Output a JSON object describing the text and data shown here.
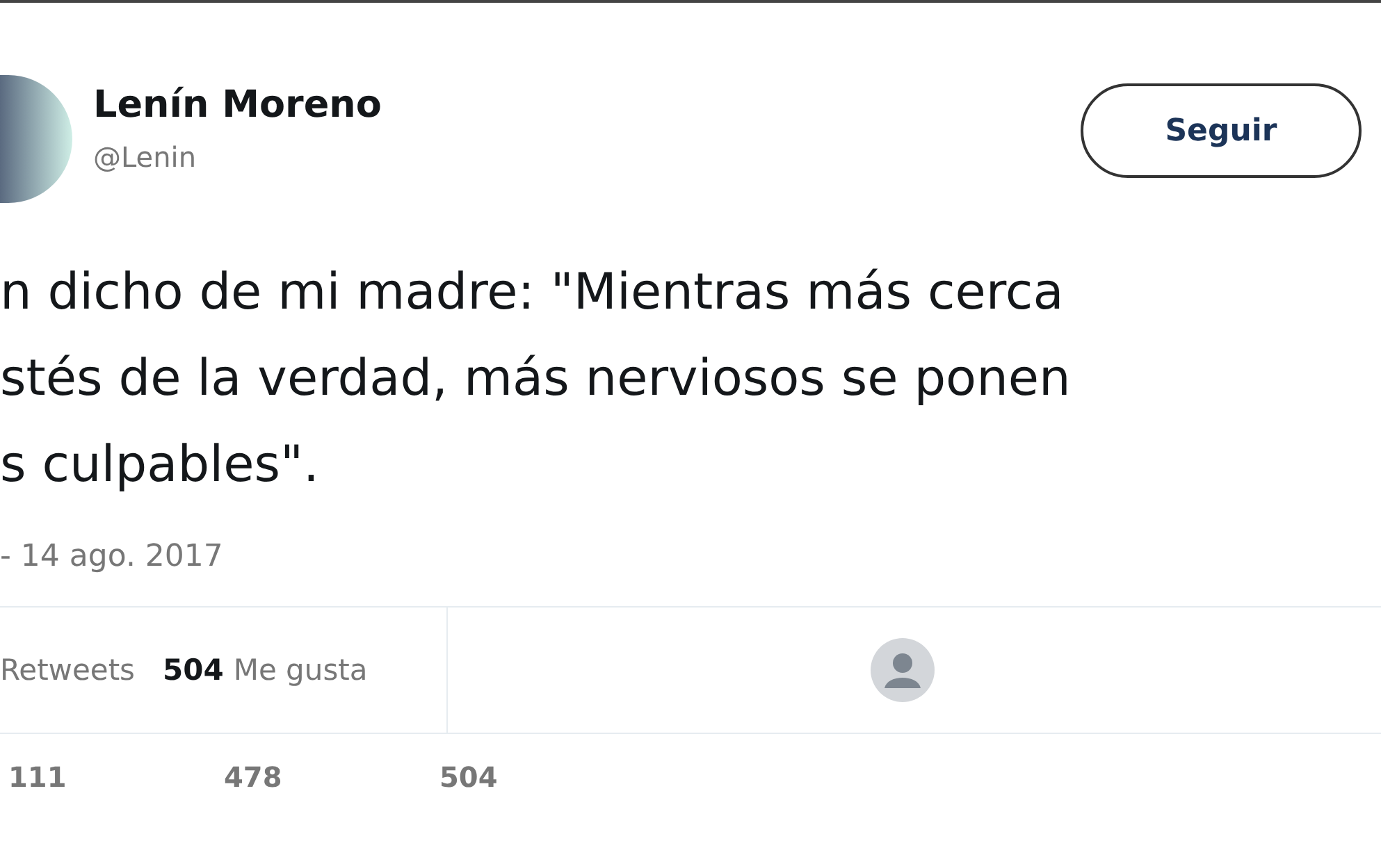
{
  "author": {
    "name": "Lenín Moreno",
    "handle": "@Lenin"
  },
  "follow_button": {
    "label": "Seguir"
  },
  "tweet": {
    "lines": [
      "n dicho de mi madre: \"Mientras más cerca",
      "stés de la verdad, más nerviosos se ponen",
      "s culpables\"."
    ],
    "date": "- 14 ago. 2017"
  },
  "stats": [
    {
      "label": "Retweets"
    },
    {
      "count": "504",
      "label": "Me gusta"
    }
  ],
  "counts": [
    "111",
    "478",
    "504"
  ]
}
